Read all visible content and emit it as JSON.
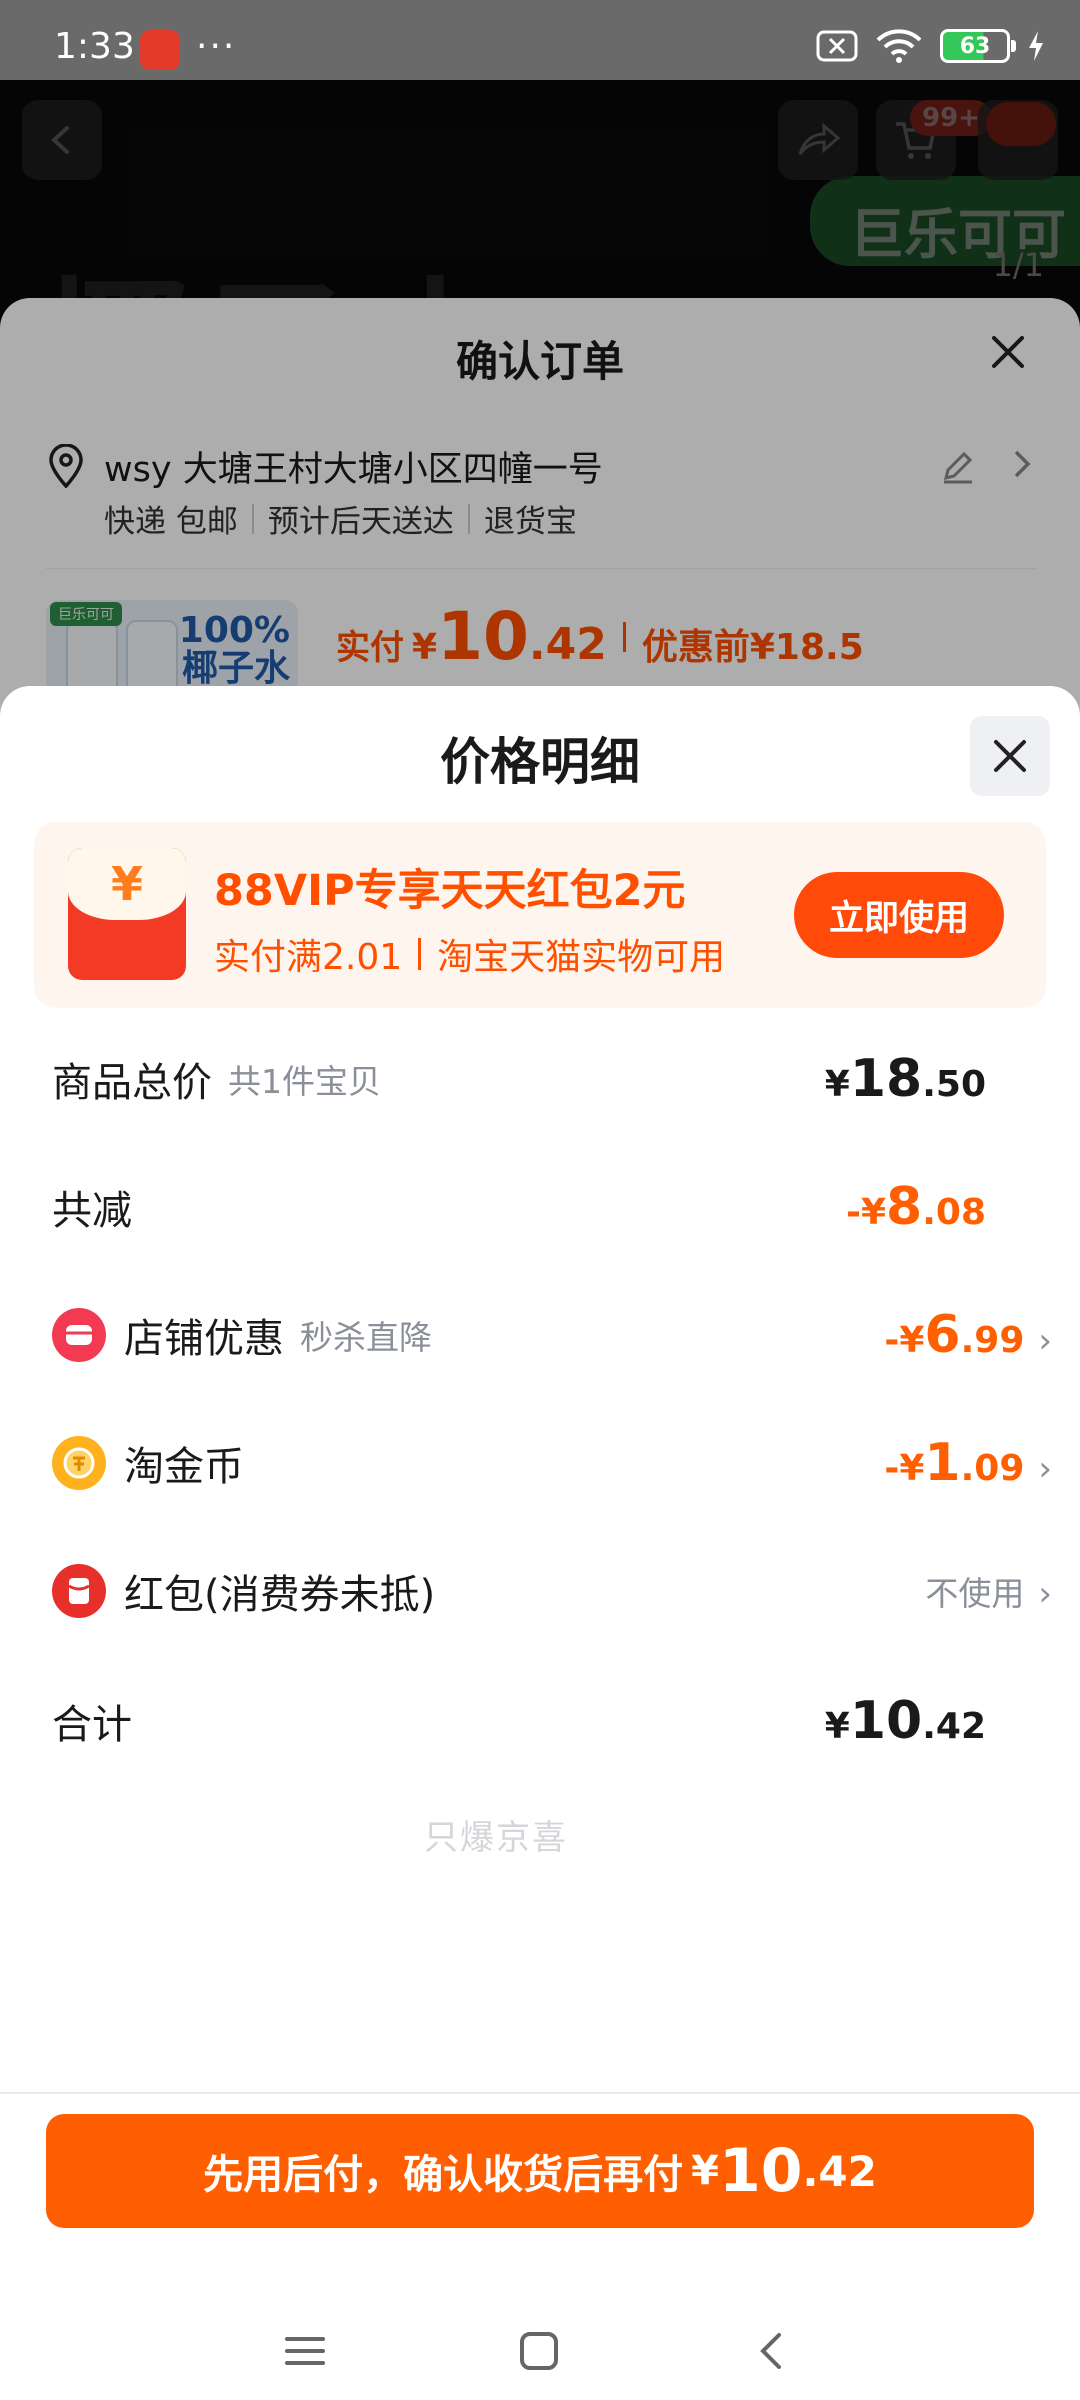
{
  "status_bar": {
    "time": "1:33",
    "overflow": "···",
    "battery": "63"
  },
  "product_page": {
    "hero_text": "椰子水",
    "brand_badge": "巨乐可可",
    "image_counter": "1/1",
    "cart_badge": "99+"
  },
  "order_sheet": {
    "title": "确认订单",
    "address": "wsy 大塘王村大塘小区四幢一号",
    "delivery": [
      "快递 包邮",
      "预计后天送达",
      "退货宝"
    ],
    "product_thumb_tag": "巨乐可可",
    "product_thumb_text": "100%\n椰子水",
    "paid_label": "实付",
    "currency": "¥",
    "paid_int": "10",
    "paid_dec": ".42",
    "before_discount": "优惠前¥18.5"
  },
  "price_detail": {
    "title": "价格明细",
    "promo": {
      "title": "88VIP专享天天红包2元",
      "condition": "实付满2.01",
      "scope": "淘宝天猫实物可用",
      "button": "立即使用"
    },
    "items": {
      "subtotal": {
        "label": "商品总价",
        "hint": "共1件宝贝",
        "cur": "¥",
        "int": "18",
        "dec": ".50"
      },
      "total_discount": {
        "label": "共减",
        "cur": "-¥",
        "int": "8",
        "dec": ".08"
      },
      "shop_discount": {
        "label": "店铺优惠",
        "hint": "秒杀直降",
        "cur": "-¥",
        "int": "6",
        "dec": ".99"
      },
      "taojinbi": {
        "label": "淘金币",
        "cur": "-¥",
        "int": "1",
        "dec": ".09"
      },
      "red_packet": {
        "label": "红包(消费券未抵)",
        "value": "不使用"
      },
      "total": {
        "label": "合计",
        "cur": "¥",
        "int": "10",
        "dec": ".42"
      }
    },
    "watermark": "只爆京喜",
    "pay_button": {
      "text": "先用后付，确认收货后再付",
      "cur": "¥",
      "int": "10",
      "dec": ".42"
    }
  },
  "colors": {
    "accent": "#ff5f00",
    "promo_bg": "#fff5ef",
    "text": "#1a1a1a",
    "muted": "#8a8f99"
  }
}
